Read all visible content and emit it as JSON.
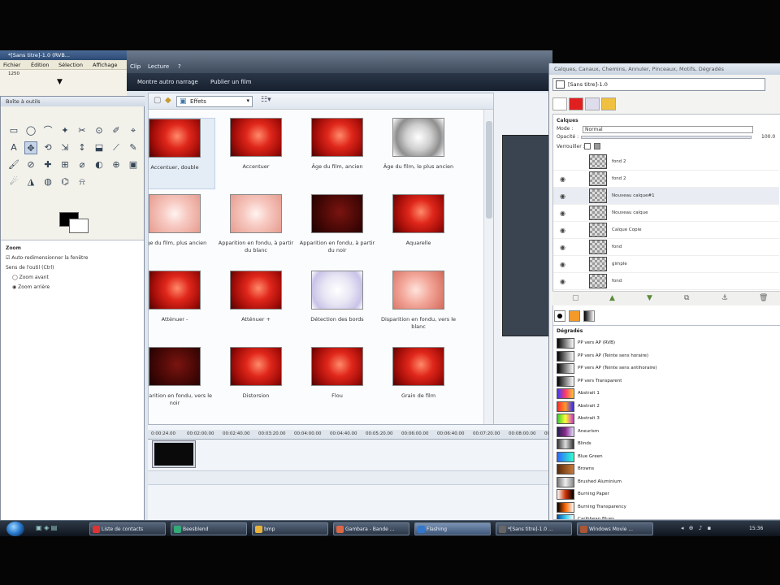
{
  "movie_maker": {
    "menus": [
      "Clip",
      "Lecture",
      "?"
    ],
    "toolbar": [
      "Montre autro narrage",
      "Publier un film"
    ],
    "effects_dropdown": "Effets",
    "effects": [
      {
        "label": "Accentuer, double",
        "thumb": "t-red",
        "selected": true
      },
      {
        "label": "Accentuer",
        "thumb": "t-red"
      },
      {
        "label": "Âge du film, ancien",
        "thumb": "t-red"
      },
      {
        "label": "Âge du film, le plus ancien",
        "thumb": "t-gray"
      },
      {
        "label": "Âge du film, plus ancien",
        "thumb": "t-pale"
      },
      {
        "label": "Apparition en fondu, à partir du blanc",
        "thumb": "t-pale"
      },
      {
        "label": "Apparition en fondu, à partir du noir",
        "thumb": "t-dark"
      },
      {
        "label": "Aquarelle",
        "thumb": "t-red"
      },
      {
        "label": "Atténuer -",
        "thumb": "t-red"
      },
      {
        "label": "Atténuer +",
        "thumb": "t-red"
      },
      {
        "label": "Détection des bords",
        "thumb": "t-white"
      },
      {
        "label": "Disparition en fondu, vers le blanc",
        "thumb": "t-pink"
      },
      {
        "label": "Disparition en fondu, vers le noir",
        "thumb": "t-dark"
      },
      {
        "label": "Distorsion",
        "thumb": "t-red"
      },
      {
        "label": "Flou",
        "thumb": "t-red"
      },
      {
        "label": "Grain de film",
        "thumb": "t-red"
      }
    ],
    "timeline_ticks": [
      "0:00:24.00",
      "00:02:00.00",
      "00:02:40.00",
      "00:03:20.00",
      "00:04:00.00",
      "00:04:40.00",
      "00:05:20.00",
      "00:06:00.00",
      "00:06:40.00",
      "00:07:20.00",
      "00:08:00.00",
      "00:08:40.00"
    ]
  },
  "gimp_main": {
    "title": "*[Sans titre]-1.0 (RVB...",
    "menus": [
      "Fichier",
      "Édition",
      "Sélection",
      "Affichage"
    ],
    "zoom": "1250"
  },
  "toolbox": {
    "title": "Boîte à outils",
    "tools": [
      "▭",
      "◯",
      "⌒",
      "✦",
      "✂",
      "⊙",
      "✐",
      "⌖",
      "A",
      "✥",
      "⟲",
      "⇲",
      "↕",
      "⬓",
      "⟋",
      "✎",
      "🖌",
      "⊘",
      "✚",
      "⊞",
      "⌀",
      "◐",
      "⊕",
      "▣",
      "☄",
      "◮",
      "◍",
      "⌬",
      "⍾"
    ],
    "options_title": "Zoom",
    "opt_auto": "Auto-redimensionner la fenêtre",
    "opt_dir": "Sens de l'outil (Ctrl)",
    "opt_zoom_in": "Zoom avant",
    "opt_zoom_out": "Zoom arrière"
  },
  "dock": {
    "title": "Calques, Canaux, Chemins, Annuler, Pinceaux, Motifs, Dégradés",
    "image_selector": "[Sans titre]-1.0",
    "layers_label": "Calques",
    "mode_label": "Mode :",
    "mode_value": "Normal",
    "opacity_label": "Opacité :",
    "opacity_value": "100.0",
    "lock_label": "Verrouiller :",
    "layers": [
      {
        "name": "fond 2",
        "visible": false
      },
      {
        "name": "fond 2",
        "visible": true
      },
      {
        "name": "Nouveau calque#1",
        "visible": true,
        "active": true
      },
      {
        "name": "Nouveau calque",
        "visible": true
      },
      {
        "name": "Calque Copie",
        "visible": true
      },
      {
        "name": "fond",
        "visible": true
      },
      {
        "name": "gimple",
        "visible": true
      },
      {
        "name": "fond",
        "visible": true
      }
    ],
    "gradients_label": "Dégradés",
    "gradients": [
      {
        "name": "PP vers AP (RVB)",
        "colors": [
          "#000000",
          "#ffffff"
        ]
      },
      {
        "name": "PP vers AP (Teinte sens horaire)",
        "colors": [
          "#000000",
          "#ffffff"
        ]
      },
      {
        "name": "PP vers AP (Teinte sens antihoraire)",
        "colors": [
          "#000000",
          "#ffffff"
        ]
      },
      {
        "name": "PP vers Transparent",
        "colors": [
          "#000000",
          "#ffffff"
        ]
      },
      {
        "name": "Abstrait 1",
        "colors": [
          "#3a3aff",
          "#ff3a6a",
          "#ffcc33"
        ]
      },
      {
        "name": "Abstrait 2",
        "colors": [
          "#ff2a2a",
          "#ff9a2a",
          "#2a2aff"
        ]
      },
      {
        "name": "Abstrait 3",
        "colors": [
          "#33cc33",
          "#ffff33",
          "#cc33cc"
        ]
      },
      {
        "name": "Aneurism",
        "colors": [
          "#202050",
          "#8a2a8a",
          "#e0e0ff"
        ]
      },
      {
        "name": "Blinds",
        "colors": [
          "#333333",
          "#dddddd",
          "#333333"
        ]
      },
      {
        "name": "Blue Green",
        "colors": [
          "#2a66ff",
          "#33ffcc"
        ]
      },
      {
        "name": "Browns",
        "colors": [
          "#5a2a0a",
          "#c87a3a"
        ]
      },
      {
        "name": "Brushed Aluminium",
        "colors": [
          "#777777",
          "#eeeeee",
          "#888888"
        ]
      },
      {
        "name": "Burning Paper",
        "colors": [
          "#ffffff",
          "#cc3300",
          "#000000"
        ]
      },
      {
        "name": "Burning Transparency",
        "colors": [
          "#000000",
          "#ff6600",
          "#ffffff"
        ]
      },
      {
        "name": "Caribbean Blues",
        "colors": [
          "#0a4aa0",
          "#33ccee",
          "#ffffff"
        ]
      }
    ]
  },
  "taskbar": {
    "buttons": [
      {
        "label": "Liste de contacts",
        "color": "#d33"
      },
      {
        "label": "Beesblend",
        "color": "#3a7"
      },
      {
        "label": "bmp",
        "color": "#e8b33a"
      },
      {
        "label": "Gambara - Bande ...",
        "color": "#d64"
      },
      {
        "label": "Flashing",
        "color": "#37c",
        "active": true
      },
      {
        "label": "*[Sans titre]-1.0 ...",
        "color": "#666"
      },
      {
        "label": "Windows Movie ...",
        "color": "#a53"
      }
    ],
    "clock": "15:36",
    "tray": "◂ ⊕ ♪ ▪"
  }
}
